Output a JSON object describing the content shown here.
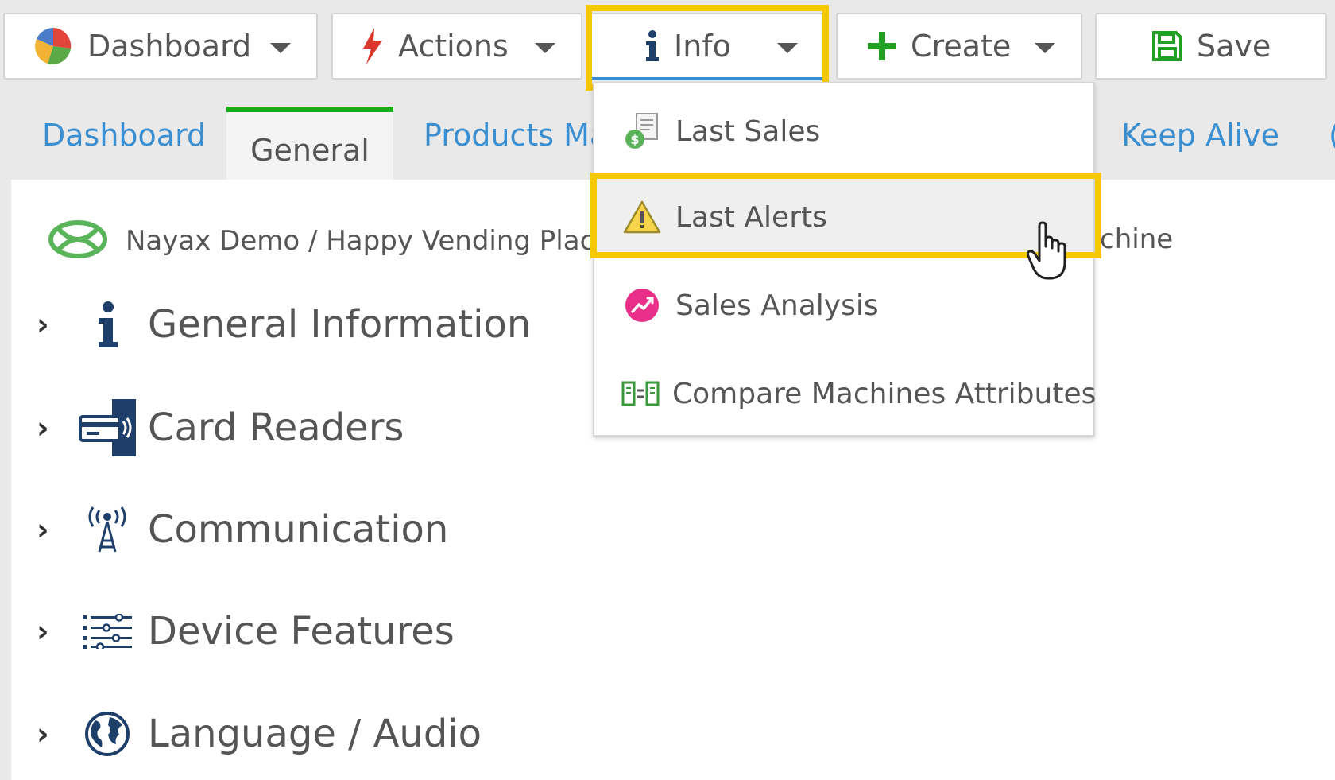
{
  "toolbar": {
    "dashboard_label": "Dashboard",
    "actions_label": "Actions",
    "info_label": "Info",
    "create_label": "Create",
    "save_label": "Save"
  },
  "tabs": {
    "dashboard": "Dashboard",
    "general": "General",
    "products": "Products Ma",
    "keep_alive": "Keep Alive"
  },
  "breadcrumb": {
    "text": "Nayax Demo / Happy Vending Plac",
    "tail": "chine"
  },
  "sections": [
    {
      "label": "General Information",
      "icon": "info-icon"
    },
    {
      "label": "Card Readers",
      "icon": "card-reader-icon"
    },
    {
      "label": "Communication",
      "icon": "antenna-icon"
    },
    {
      "label": "Device Features",
      "icon": "sliders-icon"
    },
    {
      "label": "Language / Audio",
      "icon": "globe-icon"
    }
  ],
  "info_menu": {
    "items": [
      {
        "label": "Last Sales",
        "icon": "sales-receipt-icon"
      },
      {
        "label": "Last Alerts",
        "icon": "warning-icon"
      },
      {
        "label": "Sales Analysis",
        "icon": "analysis-chart-icon"
      },
      {
        "label": "Compare Machines Attributes",
        "icon": "compare-icon"
      }
    ],
    "hovered_item": "Last Alerts"
  },
  "colors": {
    "highlight": "#f6c800",
    "tab_accent": "#1aad1a",
    "link_blue": "#3b8fd0",
    "create_green": "#22a022",
    "actions_red": "#d9382c"
  }
}
